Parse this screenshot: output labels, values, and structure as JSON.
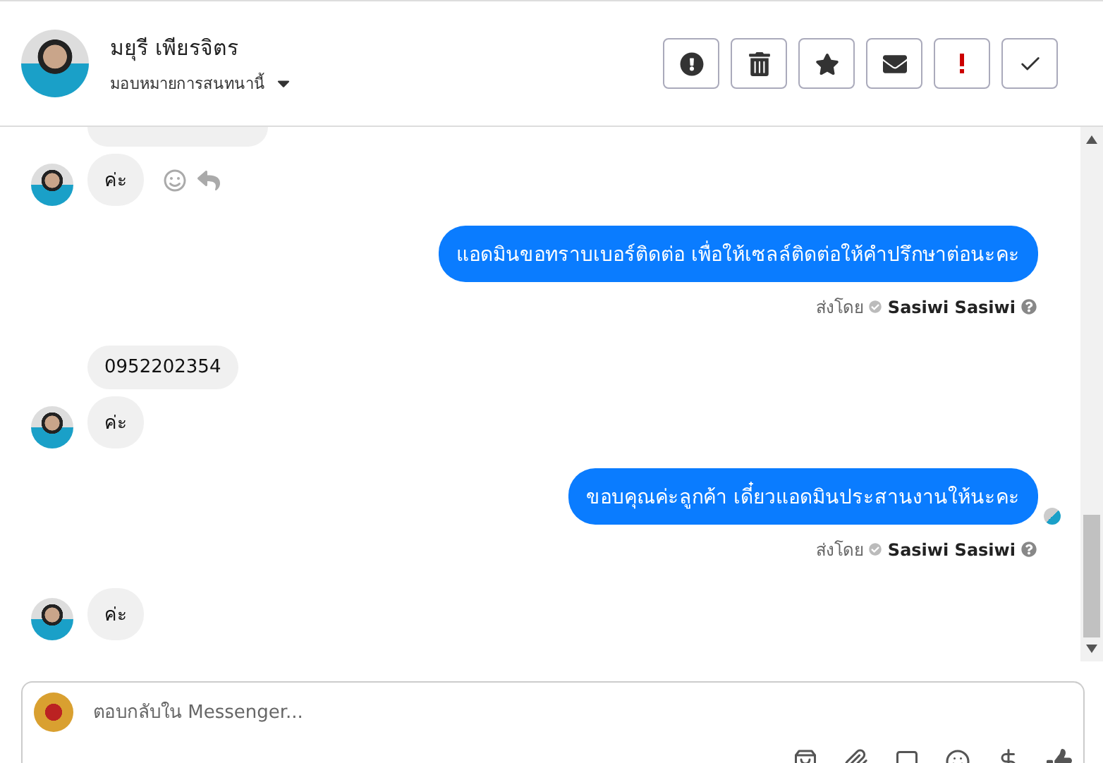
{
  "header": {
    "name": "มยุรี เพียรจิตร",
    "assign_label": "มอบหมายการสนทนานี้",
    "actions": [
      {
        "kind": "alert"
      },
      {
        "kind": "delete"
      },
      {
        "kind": "star"
      },
      {
        "kind": "unread"
      },
      {
        "kind": "important"
      },
      {
        "kind": "done"
      }
    ]
  },
  "messages": [
    {
      "kind": "incoming",
      "partial_above": true,
      "bubbles": [
        "ค่ะ"
      ],
      "reactions": true
    },
    {
      "kind": "outgoing",
      "text": "แอดมินขอทราบเบอร์ติดต่อ เพื่อให้เซลล์ติดต่อให้คำปรึกษาต่อนะคะ",
      "sent_by": "ส่งโดย",
      "sender": "Sasiwi Sasiwi",
      "seen": false
    },
    {
      "kind": "incoming",
      "partial_above": false,
      "bubbles": [
        "0952202354",
        "ค่ะ"
      ],
      "reactions": false
    },
    {
      "kind": "outgoing",
      "text": "ขอบคุณค่ะลูกค้า เดี๋ยวแอดมินประสานงานให้นะคะ",
      "sent_by": "ส่งโดย",
      "sender": "Sasiwi Sasiwi",
      "seen": true
    },
    {
      "kind": "incoming",
      "partial_above": false,
      "bubbles": [
        "ค่ะ"
      ],
      "reactions": false
    }
  ],
  "composer": {
    "placeholder": "ตอบกลับใน Messenger..."
  }
}
